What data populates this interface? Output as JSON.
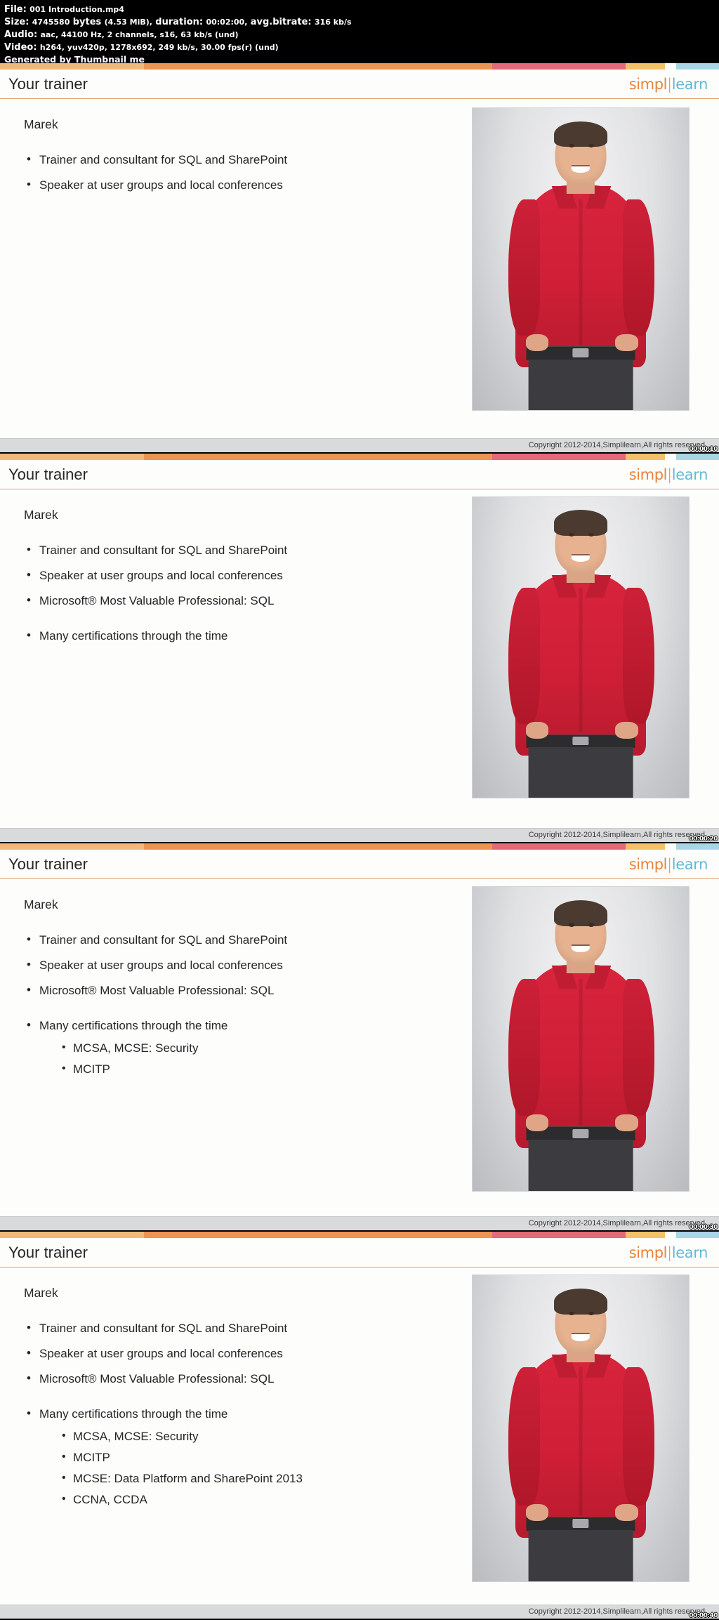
{
  "meta": {
    "file_label": "File:",
    "file_value": "001 Introduction.mp4",
    "size_label": "Size:",
    "size_value": "4745580",
    "size_unit": "bytes",
    "size_human": "(4.53 MiB),",
    "duration_label": "duration:",
    "duration_value": "00:02:00,",
    "bitrate_label": "avg.bitrate:",
    "bitrate_value": "316 kb/s",
    "audio_label": "Audio:",
    "audio_value": "aac, 44100 Hz, 2 channels, s16, 63 kb/s (und)",
    "video_label": "Video:",
    "video_value": "h264, yuv420p, 1278x692, 249 kb/s, 30.00 fps(r) (und)",
    "generator": "Generated by Thumbnail me"
  },
  "ribbon": [
    {
      "color": "#f0b97a",
      "width": "20%"
    },
    {
      "color": "#ee9453",
      "width": "48.5%"
    },
    {
      "color": "#e4697a",
      "width": "18.5%"
    },
    {
      "color": "#f2c168",
      "width": "5.5%"
    },
    {
      "color": "#fdfdfc",
      "width": "1.5%"
    },
    {
      "color": "#a8d6e6",
      "width": "6%"
    }
  ],
  "logo": {
    "part1": "simpl",
    "separator": "|",
    "part2": "learn",
    "color1": "#e8833a",
    "color2": "#63b9d4"
  },
  "common": {
    "title": "Your trainer",
    "name": "Marek",
    "copyright": "Copyright 2012-2014,Simplilearn,All rights reserved"
  },
  "slides": [
    {
      "title": "Your trainer",
      "name": "Marek",
      "timestamp": "00:00:10",
      "bullets": [
        {
          "text": "Trainer and consultant for SQL and SharePoint",
          "gap": false,
          "sub": []
        },
        {
          "text": "Speaker at user groups and local conferences",
          "gap": false,
          "sub": []
        }
      ]
    },
    {
      "title": "Your trainer",
      "name": "Marek",
      "timestamp": "00:00:20",
      "bullets": [
        {
          "text": "Trainer and consultant for SQL and SharePoint",
          "gap": false,
          "sub": []
        },
        {
          "text": "Speaker at user groups and local conferences",
          "gap": false,
          "sub": []
        },
        {
          "text": "Microsoft® Most Valuable Professional: SQL",
          "gap": false,
          "sub": []
        },
        {
          "text": "Many certifications through the time",
          "gap": true,
          "sub": []
        }
      ]
    },
    {
      "title": "Your trainer",
      "name": "Marek",
      "timestamp": "00:00:30",
      "bullets": [
        {
          "text": "Trainer and consultant for SQL and SharePoint",
          "gap": false,
          "sub": []
        },
        {
          "text": "Speaker at user groups and local conferences",
          "gap": false,
          "sub": []
        },
        {
          "text": "Microsoft® Most Valuable Professional: SQL",
          "gap": false,
          "sub": []
        },
        {
          "text": "Many certifications through the time",
          "gap": true,
          "sub": [
            "MCSA, MCSE: Security",
            "MCITP"
          ]
        }
      ]
    },
    {
      "title": "Your trainer",
      "name": "Marek",
      "timestamp": "00:00:40",
      "bullets": [
        {
          "text": "Trainer and consultant for SQL and SharePoint",
          "gap": false,
          "sub": []
        },
        {
          "text": "Speaker at user groups and local conferences",
          "gap": false,
          "sub": []
        },
        {
          "text": "Microsoft® Most Valuable Professional: SQL",
          "gap": false,
          "sub": []
        },
        {
          "text": "Many certifications through the time",
          "gap": true,
          "sub": [
            "MCSA, MCSE: Security",
            "MCITP",
            "MCSE: Data Platform and SharePoint 2013",
            "CCNA, CCDA"
          ]
        }
      ]
    }
  ]
}
